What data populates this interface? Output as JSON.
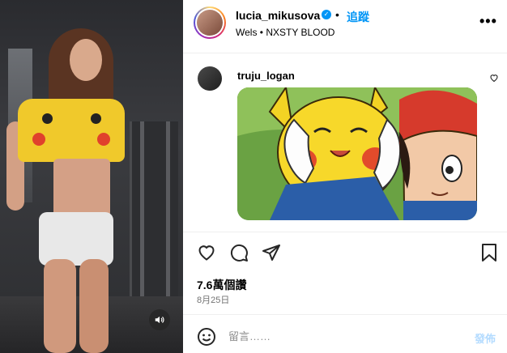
{
  "header": {
    "username": "lucia_mikusova",
    "verified_icon": "verified-badge-icon",
    "separator": "•",
    "follow_label": "追蹤",
    "location_line": "Wels • NXSTY BLOOD",
    "more_label": "•••"
  },
  "comment": {
    "username": "truju_logan",
    "gif_description_icon": "pikachu-gif"
  },
  "actions": {
    "like_icon": "heart-icon",
    "comment_icon": "comment-icon",
    "share_icon": "send-icon",
    "save_icon": "bookmark-icon"
  },
  "stats": {
    "views": "7.6萬個讚",
    "date": "8月25日"
  },
  "composer": {
    "placeholder": "留言……",
    "post_label": "發佈"
  },
  "colors": {
    "accent": "#0095f6",
    "post_disabled": "#b3dbff"
  }
}
